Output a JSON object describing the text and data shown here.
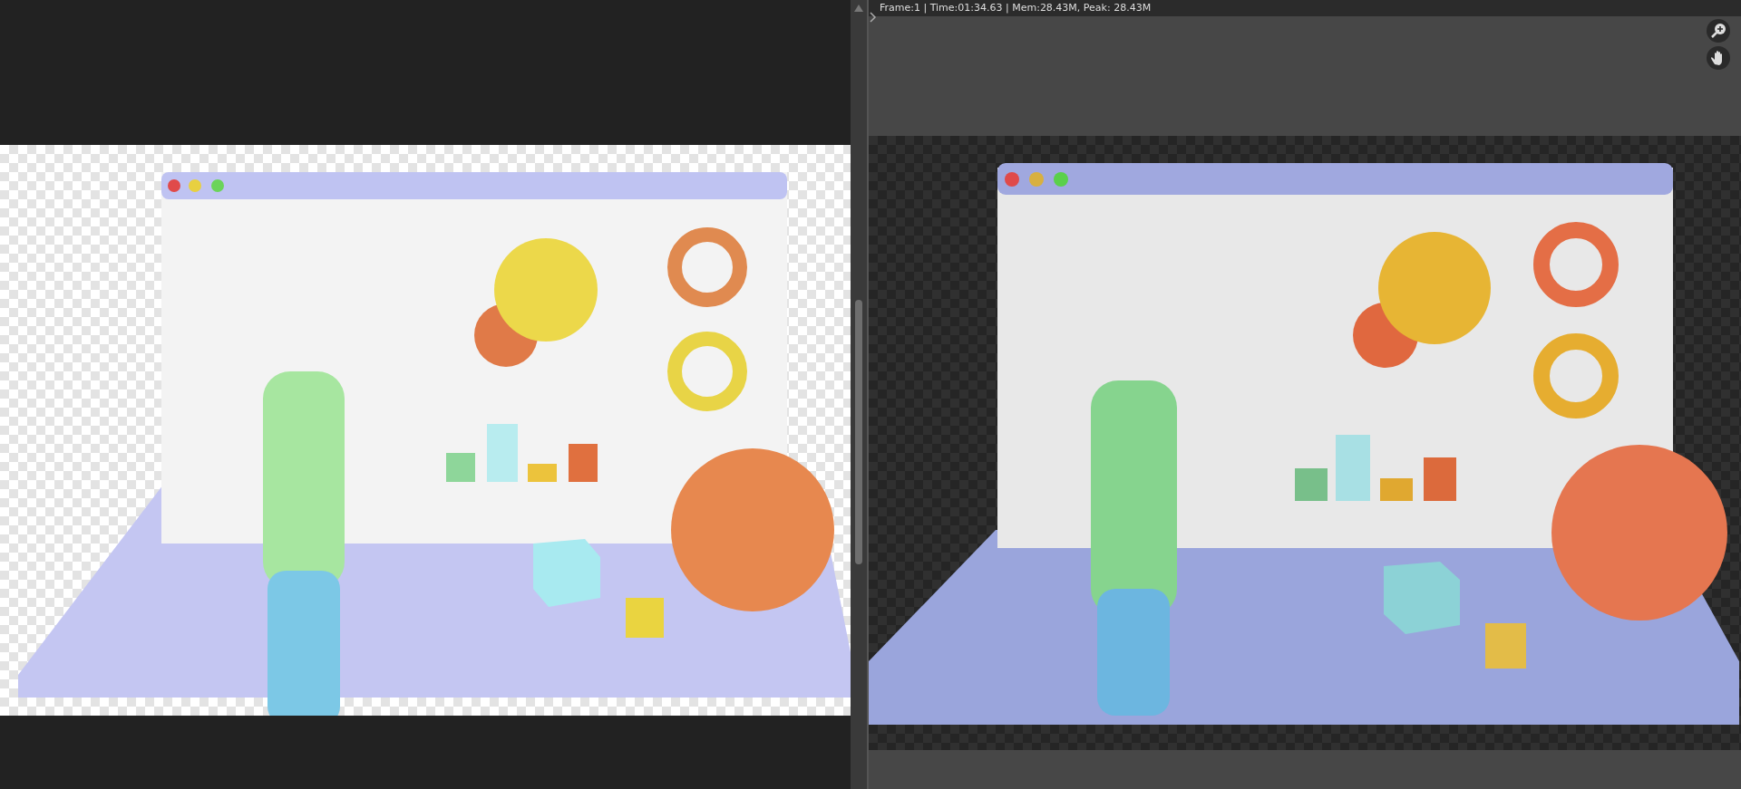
{
  "render_view": {
    "status": "Frame:1 | Time:01:34.63 | Mem:28.43M, Peak: 28.43M"
  }
}
